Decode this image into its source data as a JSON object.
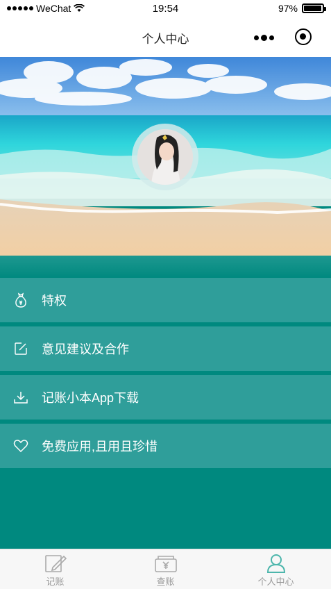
{
  "status_bar": {
    "carrier": "WeChat",
    "time": "19:54",
    "battery": "97%",
    "battery_level": 0.97
  },
  "nav": {
    "title": "个人中心",
    "more_icon": "more-dots-icon",
    "close_icon": "capsule-close-icon"
  },
  "hero": {
    "avatar_alt": "avatar"
  },
  "menu": [
    {
      "label": "特权",
      "icon": "money-bag-icon"
    },
    {
      "label": "意见建议及合作",
      "icon": "edit-icon"
    },
    {
      "label": "记账小本App下载",
      "icon": "download-icon"
    },
    {
      "label": "免费应用,且用且珍惜",
      "icon": "heart-icon"
    }
  ],
  "tabs": [
    {
      "label": "记账",
      "icon": "pencil-note-icon",
      "active": false
    },
    {
      "label": "查账",
      "icon": "wallet-yen-icon",
      "active": false
    },
    {
      "label": "个人中心",
      "icon": "person-icon",
      "active": true
    }
  ],
  "colors": {
    "teal": "#00897f",
    "menu_bg": "#2f9e9a",
    "tab_active": "#4db6ac"
  }
}
